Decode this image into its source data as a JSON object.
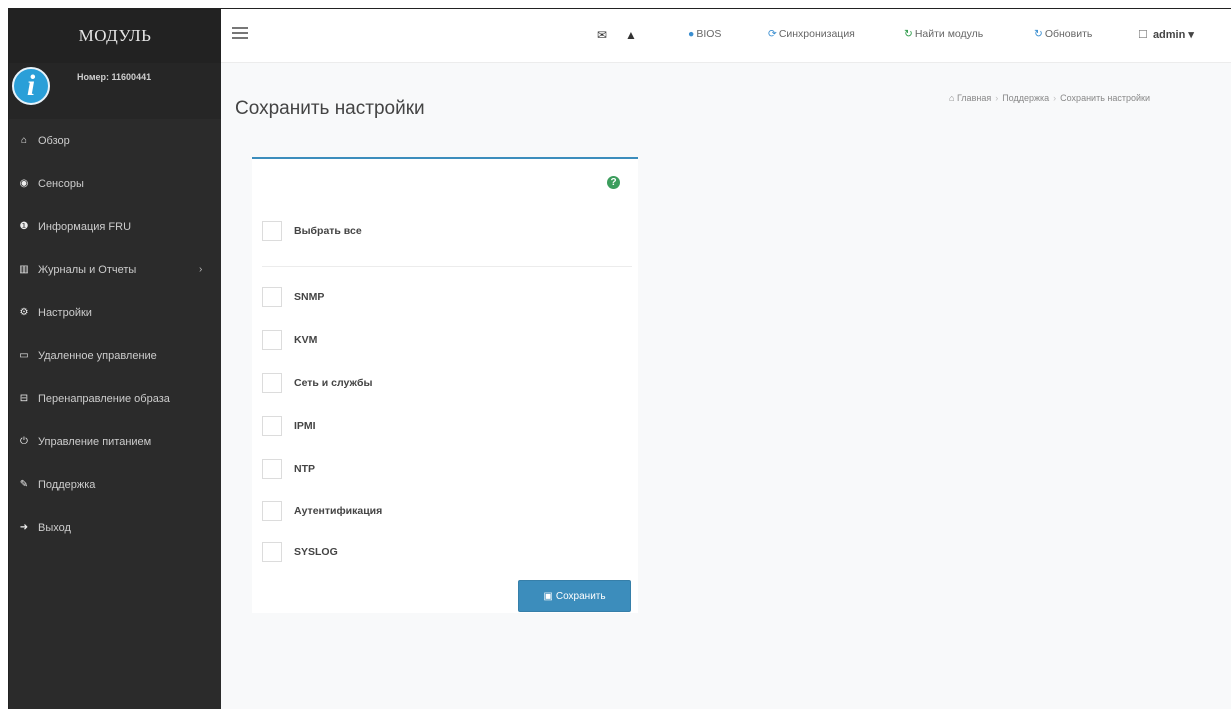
{
  "brand": "МОДУЛЬ",
  "user": {
    "number_label": "Номер: 11600441",
    "avatar_glyph": "i"
  },
  "sidebar": {
    "items": [
      {
        "label": "Обзор",
        "icon": "home-icon",
        "glyph": "⌂"
      },
      {
        "label": "Сенсоры",
        "icon": "sensor-icon",
        "glyph": "◉"
      },
      {
        "label": "Информация FRU",
        "icon": "info-icon",
        "glyph": "❶"
      },
      {
        "label": "Журналы и Отчеты",
        "icon": "chart-icon",
        "glyph": "▥",
        "has_submenu": true
      },
      {
        "label": "Настройки",
        "icon": "gear-icon",
        "glyph": "⚙"
      },
      {
        "label": "Удаленное управление",
        "icon": "monitor-icon",
        "glyph": "▭"
      },
      {
        "label": "Перенаправление образа",
        "icon": "disk-icon",
        "glyph": "⊟"
      },
      {
        "label": "Управление питанием",
        "icon": "power-icon",
        "glyph": "⏻"
      },
      {
        "label": "Поддержка",
        "icon": "wrench-icon",
        "glyph": "✎"
      },
      {
        "label": "Выход",
        "icon": "logout-icon",
        "glyph": "➜"
      }
    ]
  },
  "topbar": {
    "mail_glyph": "✉",
    "alert_glyph": "▲",
    "bios": "BIOS",
    "sync": "Синхронизация",
    "find_module": "Найти модуль",
    "refresh": "Обновить",
    "user": "admin ▾"
  },
  "page": {
    "title": "Сохранить настройки",
    "breadcrumb": [
      "Главная",
      "Поддержка",
      "Сохранить настройки"
    ]
  },
  "form": {
    "select_all": "Выбрать все",
    "options": [
      "SNMP",
      "KVM",
      "Сеть и службы",
      "IPMI",
      "NTP",
      "Аутентификация",
      "SYSLOG"
    ],
    "save_button": "Сохранить",
    "help_glyph": "?"
  },
  "colors": {
    "accent": "#3c8dbc",
    "sidebar_bg": "#2b2b2b",
    "help_green": "#3c9d5d"
  }
}
